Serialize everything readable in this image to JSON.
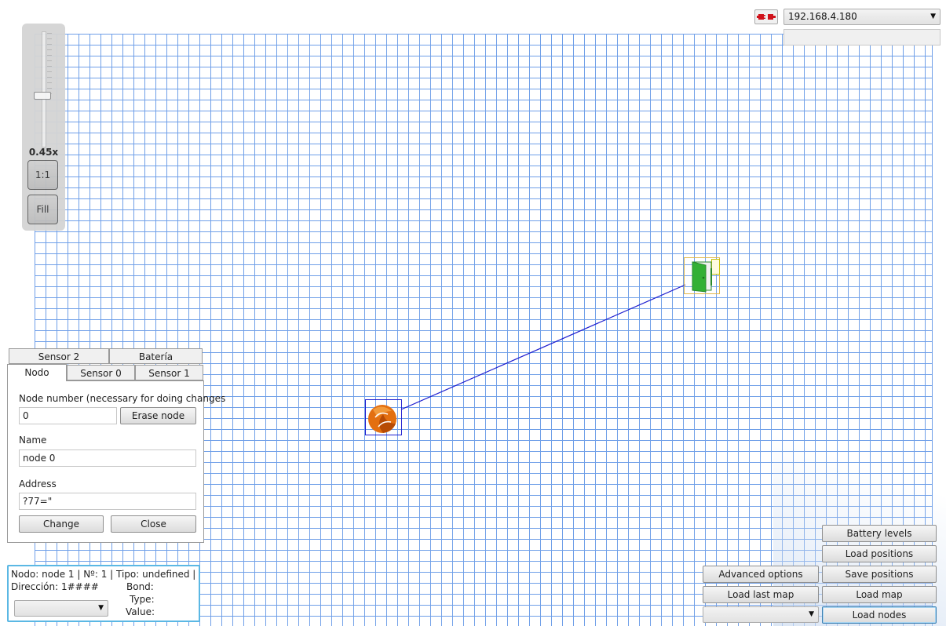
{
  "connection": {
    "ip_selected": "192.168.4.180",
    "status_text": ""
  },
  "zoom": {
    "level_label": "0.45x",
    "level_fraction": 0.45,
    "one_to_one_label": "1:1",
    "fill_label": "Fill"
  },
  "tabs": {
    "row_back": [
      "Sensor 2",
      "Batería"
    ],
    "row_front": [
      "Nodo",
      "Sensor 0",
      "Sensor 1"
    ],
    "active": "Nodo"
  },
  "editor": {
    "node_number_label": "Node number (necessary for doing changes",
    "node_number_value": "0",
    "erase_label": "Erase node",
    "name_label": "Name",
    "name_value": "node 0",
    "address_label": "Address",
    "address_value": "?77=\"",
    "change_label": "Change",
    "close_label": "Close"
  },
  "status": {
    "line1": "Nodo: node 1 | Nº: 1 | Tipo: undefined |",
    "direccion": "Dirección: 1####",
    "bond_label": "Bond:",
    "type_label": "Type:",
    "value_label": "Value:",
    "select_value": ""
  },
  "actions": {
    "battery_levels": "Battery levels",
    "load_positions": "Load positions",
    "advanced_options": "Advanced options",
    "save_positions": "Save positions",
    "load_last_map": "Load last map",
    "load_map": "Load map",
    "map_select_value": "",
    "load_nodes": "Load nodes"
  },
  "icons": {
    "connection": "disconnect-plug-icon",
    "sensor_node": "sensor-node-icon",
    "door_node": "door-node-icon"
  },
  "colors": {
    "grid": "#6f9fe8",
    "link": "#1f1fcf",
    "status_border": "#5bb8e4",
    "door": "#33b035",
    "sensor": "#e36f10"
  }
}
